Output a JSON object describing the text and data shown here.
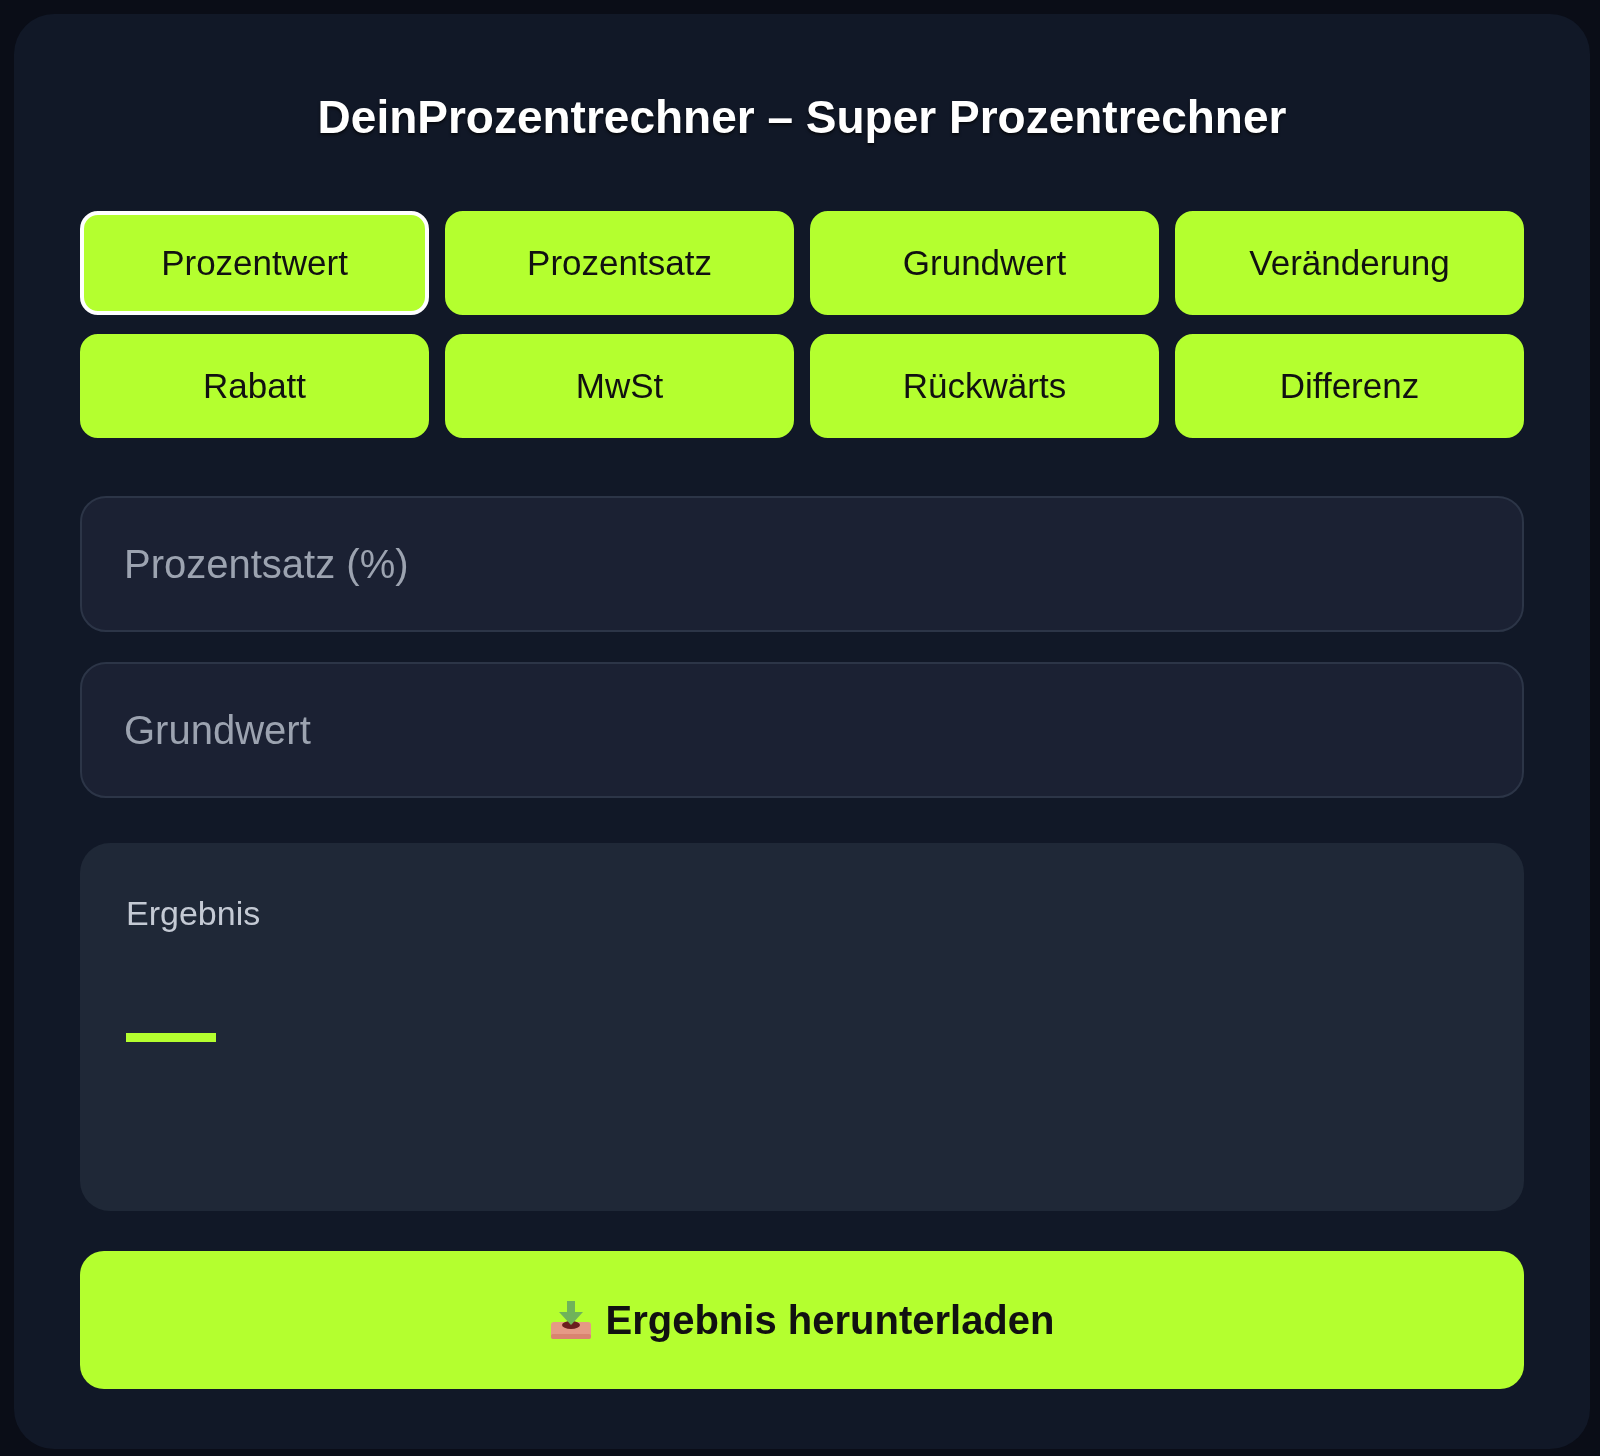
{
  "title": "DeinProzentrechner – Super Prozentrechner",
  "tabs": [
    {
      "label": "Prozentwert",
      "selected": true
    },
    {
      "label": "Prozentsatz",
      "selected": false
    },
    {
      "label": "Grundwert",
      "selected": false
    },
    {
      "label": "Veränderung",
      "selected": false
    },
    {
      "label": "Rabatt",
      "selected": false
    },
    {
      "label": "MwSt",
      "selected": false
    },
    {
      "label": "Rückwärts",
      "selected": false
    },
    {
      "label": "Differenz",
      "selected": false
    }
  ],
  "fields": [
    {
      "placeholder": "Prozentsatz (%)"
    },
    {
      "placeholder": "Grundwert"
    }
  ],
  "result": {
    "label": "Ergebnis",
    "value": "—"
  },
  "download_button": {
    "label": "Ergebnis herunterladen"
  }
}
